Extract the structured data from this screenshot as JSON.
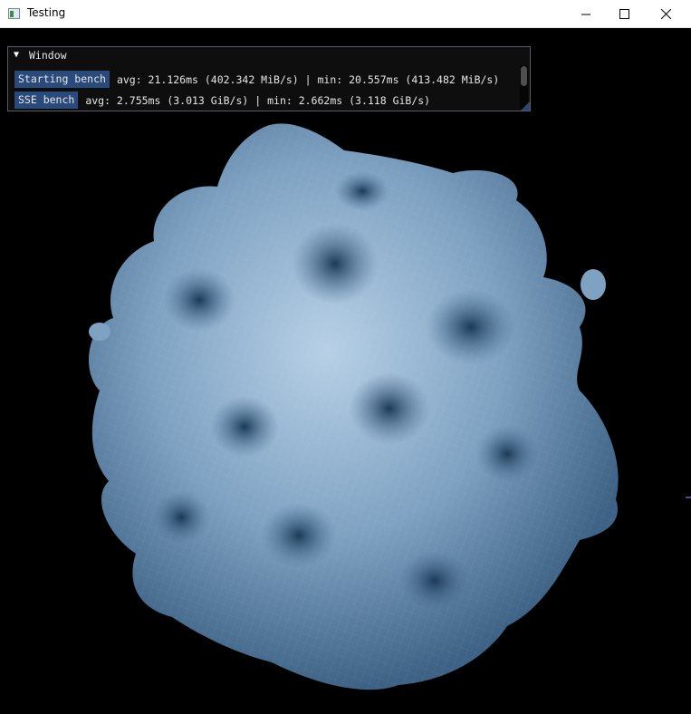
{
  "window": {
    "title": "Testing",
    "controls": {
      "minimize": "—",
      "maximize": "☐",
      "close": "✕"
    }
  },
  "panel": {
    "title": "Window",
    "rows": [
      {
        "button": "Starting bench",
        "text": "avg: 21.126ms (402.342 MiB/s) | min: 20.557ms (413.482 MiB/s)"
      },
      {
        "button": "SSE bench",
        "text": "avg: 2.755ms (3.013 GiB/s) | min: 2.662ms (3.118 GiB/s)"
      }
    ]
  },
  "render": {
    "object": "blob-mesh",
    "colors": {
      "surface": "#8fb1d0",
      "shadow": "#1a3550",
      "background": "#000000",
      "accent_button": "#294a7a"
    }
  }
}
